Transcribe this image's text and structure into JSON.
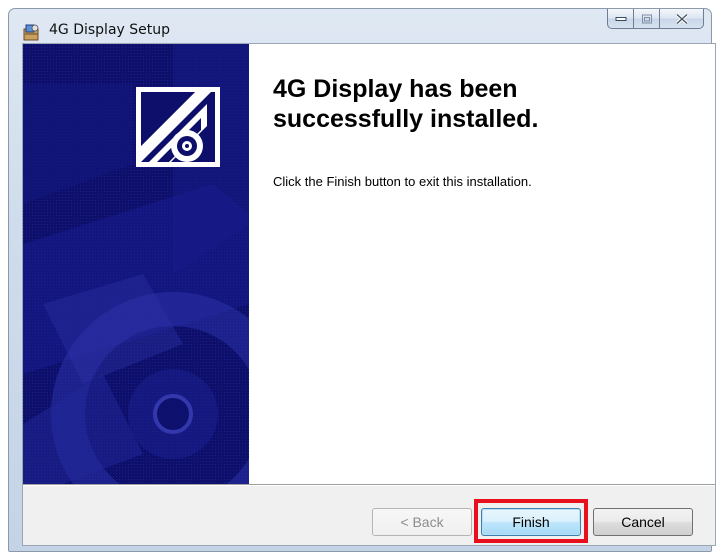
{
  "window": {
    "title": "4G Display Setup",
    "icons": {
      "app": "installer-icon",
      "minimize": "minimize-icon",
      "maximize": "maximize-icon",
      "close": "close-icon"
    }
  },
  "banner": {
    "logo": "installer-cd-logo"
  },
  "content": {
    "heading": "4G Display has been\nsuccessfully installed.",
    "message": "Click the Finish button to exit this installation."
  },
  "footer": {
    "back_label": "< Back",
    "finish_label": "Finish",
    "cancel_label": "Cancel"
  },
  "colors": {
    "banner": "#0d0f6a",
    "highlight": "#e8101d"
  }
}
